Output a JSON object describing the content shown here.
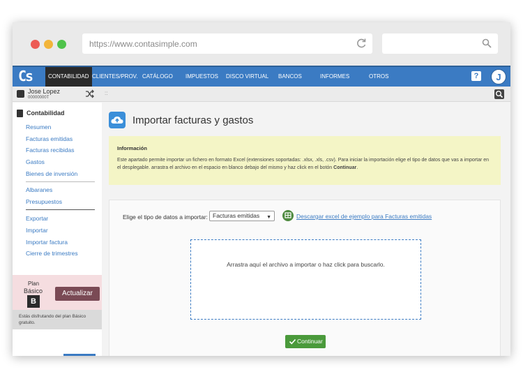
{
  "browser": {
    "url": "https://www.contasimple.com"
  },
  "topnav": {
    "logo": "Cs",
    "items": [
      {
        "label": "CONTABILIDAD",
        "active": true
      },
      {
        "label": "CLIENTES/PROV."
      },
      {
        "label": "CATÁLOGO"
      },
      {
        "label": "IMPUESTOS"
      },
      {
        "label": "DISCO VIRTUAL"
      },
      {
        "label": "BANCOS"
      },
      {
        "label": "INFORMES"
      },
      {
        "label": "OTROS"
      }
    ],
    "help": "?",
    "avatar_initial": "J"
  },
  "user": {
    "name": "Jose Lopez",
    "id": "00000000T"
  },
  "toolbar": {
    "dots": "::"
  },
  "sidebar": {
    "section_title": "Contabilidad",
    "group1": [
      "Resumen",
      "Facturas emitidas",
      "Facturas recibidas",
      "Gastos",
      "Bienes de inversión"
    ],
    "group2": [
      "Albaranes",
      "Presupuestos"
    ],
    "group3": [
      "Exportar",
      "Importar",
      "Importar factura",
      "Cierre de trimestres"
    ],
    "plan": {
      "label": "Plan",
      "name": "Básico",
      "badge": "B",
      "upgrade_label": "Actualizar",
      "note": "Estás disfrutando del plan Básico gratuito."
    }
  },
  "main": {
    "title": "Importar facturas y gastos",
    "info": {
      "title": "Información",
      "text_before": "Este apartado permite importar un fichero en formato Excel (extensiones soportadas: .xlsx, .xls, .csv). Para iniciar la importación elige el tipo de datos que vas a importar en el desplegable. arrastra el archivo en el espacio en blanco debajo del mismo y haz click en el botón ",
      "text_bold": "Continuar",
      "text_after": "."
    },
    "import": {
      "type_label": "Elige el tipo de datos a importar:",
      "type_selected": "Facturas emitidas",
      "download_link": "Descargar excel de ejemplo para Facturas emitidas",
      "drop_text": "Arrastra aquí el archivo a importar o haz click para buscarlo.",
      "continue_label": "Continuar"
    }
  },
  "colors": {
    "brand_blue": "#3b7bc3",
    "info_bg": "#f4f5c6",
    "continue_green": "#4a9a3b",
    "upgrade_btn": "#7a4a55"
  }
}
